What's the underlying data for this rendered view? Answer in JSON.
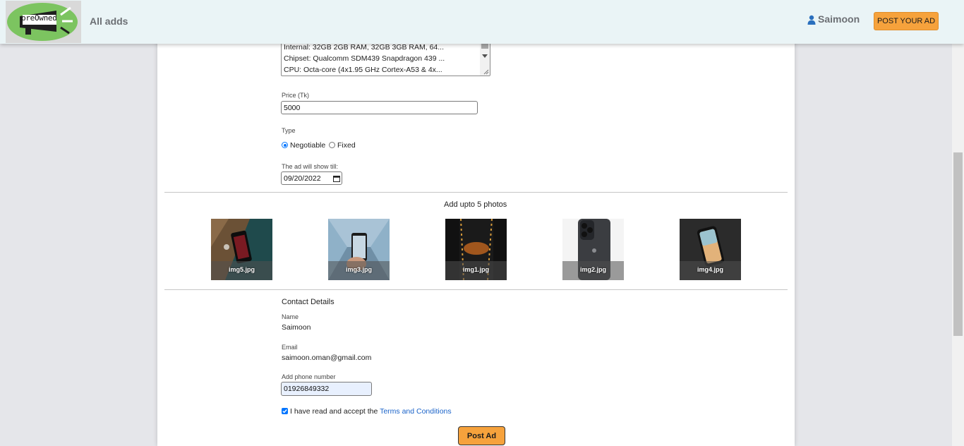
{
  "navbar": {
    "logo_text": "preOwned",
    "all_ads_label": "All adds",
    "user_name": "Saimoon",
    "post_button_label": "POST YOUR AD"
  },
  "specs": {
    "lines": [
      "Internal: 32GB 2GB RAM, 32GB 3GB RAM, 64...",
      "Chipset: Qualcomm SDM439 Snapdragon 439 ...",
      "CPU: Octa-core (4x1.95 GHz Cortex-A53 & 4x..."
    ]
  },
  "form": {
    "price_label": "Price (Tk)",
    "price_value": "5000",
    "type_label": "Type",
    "type_options": [
      "Negotiable",
      "Fixed"
    ],
    "type_selected": "Negotiable",
    "date_label": "The ad will show till:",
    "date_value": "09/20/2022"
  },
  "photos": {
    "title": "Add upto 5 photos",
    "items": [
      {
        "name": "img5.jpg"
      },
      {
        "name": "img3.jpg"
      },
      {
        "name": "img1.jpg"
      },
      {
        "name": "img2.jpg"
      },
      {
        "name": "img4.jpg"
      }
    ]
  },
  "contact": {
    "title": "Contact Details",
    "name_label": "Name",
    "name_value": "Saimoon",
    "email_label": "Email",
    "email_value": "saimoon.oman@gmail.com",
    "phone_label": "Add phone number",
    "phone_value": "01926849332"
  },
  "terms": {
    "text": "I have read and accept the ",
    "link": "Terms and Conditions",
    "checked": true
  },
  "submit_label": "Post Ad",
  "colors": {
    "accent": "#f6a23c",
    "link": "#1a63c9",
    "navbar_bg": "#eaf4f6",
    "radio_blue": "#0075ff"
  }
}
